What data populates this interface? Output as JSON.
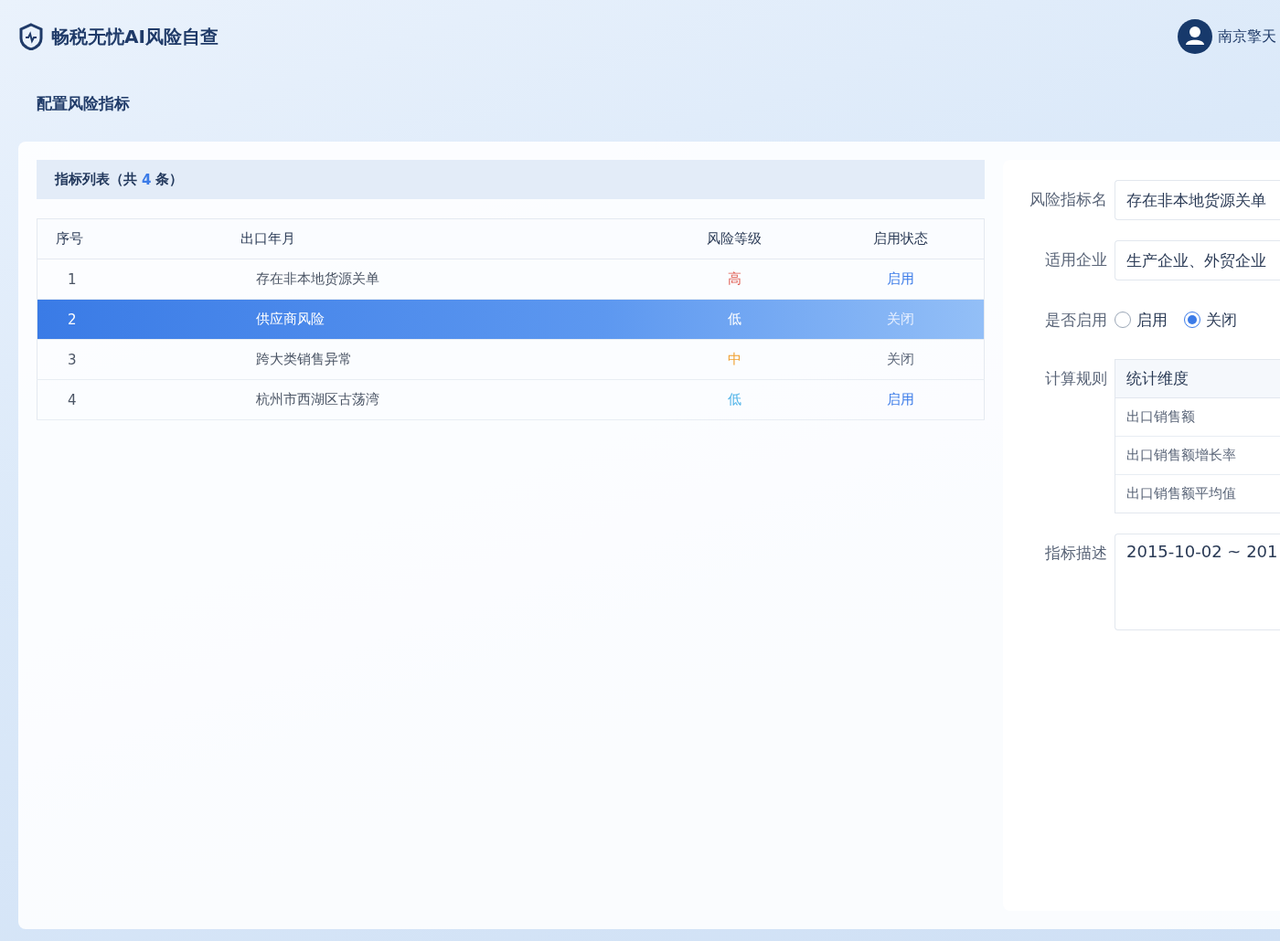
{
  "header": {
    "app_title": "畅税无忧AI风险自查",
    "user_name": "南京擎天"
  },
  "page_title": "配置风险指标",
  "list": {
    "title_prefix": "指标列表（共",
    "count": "4",
    "title_suffix": "条）",
    "columns": [
      "序号",
      "出口年月",
      "风险等级",
      "启用状态"
    ],
    "rows": [
      {
        "index": "1",
        "name": "存在非本地货源关单",
        "risk": "高",
        "color": "#e05a4f",
        "status": "启用",
        "status_on": true,
        "selected": false
      },
      {
        "index": "2",
        "name": "供应商风险",
        "risk": "低",
        "color": "#ffffff",
        "status": "关闭",
        "status_on": false,
        "selected": true
      },
      {
        "index": "3",
        "name": "跨大类销售异常",
        "risk": "中",
        "color": "#f0a030",
        "status": "关闭",
        "status_on": false,
        "selected": false
      },
      {
        "index": "4",
        "name": "杭州市西湖区古荡湾",
        "risk": "低",
        "color": "#4fb3e8",
        "status": "启用",
        "status_on": true,
        "selected": false
      }
    ]
  },
  "form": {
    "name_label": "风险指标名",
    "name_value": "存在非本地货源关单",
    "company_label": "适用企业",
    "company_value": "生产企业、外贸企业",
    "enable_label": "是否启用",
    "options": [
      {
        "label": "启用",
        "selected": false
      },
      {
        "label": "关闭",
        "selected": true
      }
    ],
    "rule_label": "计算规则",
    "rule_header": "统计维度",
    "rule_rows": [
      "出口销售额",
      "出口销售额增长率",
      "出口销售额平均值"
    ],
    "desc_label": "指标描述",
    "desc_value": "2015-10-02 ~ 201"
  }
}
